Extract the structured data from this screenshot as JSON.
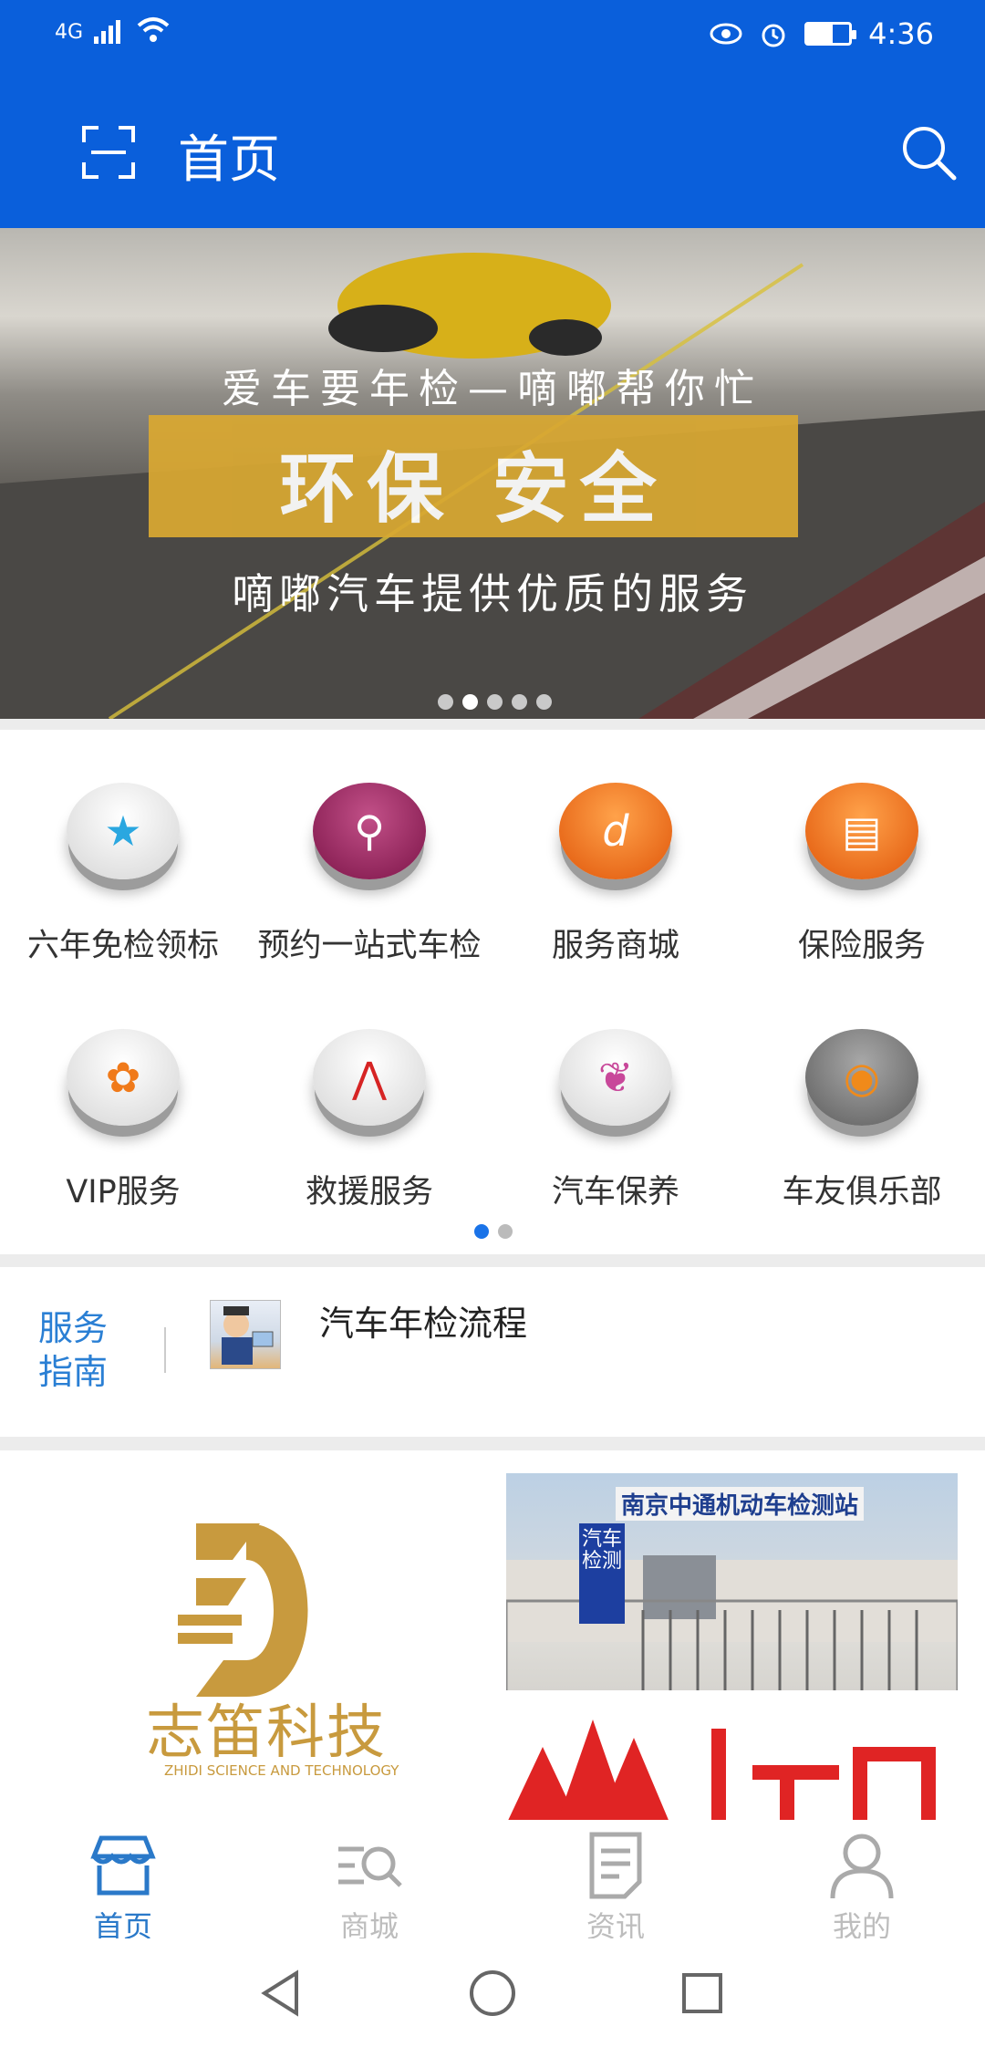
{
  "status": {
    "network": "4G",
    "time": "4:36"
  },
  "appbar": {
    "title": "首页"
  },
  "banner": {
    "line1": "爱车要年检—嘀嘟帮你忙",
    "highlight": "环保 安全",
    "line3": "嘀嘟汽车提供优质的服务",
    "active_dot": 2,
    "dot_count": 5
  },
  "services": [
    {
      "label": "六年免检领标",
      "icon": "star-icon",
      "color": "#e8e8e8"
    },
    {
      "label": "预约一站式车检",
      "icon": "key-icon",
      "color": "#a8245e"
    },
    {
      "label": "服务商城",
      "icon": "shockwave-icon",
      "color": "#f06a12"
    },
    {
      "label": "保险服务",
      "icon": "card-icon",
      "color": "#f06a12"
    },
    {
      "label": "VIP服务",
      "icon": "flower-icon",
      "color": "#e8e8e8"
    },
    {
      "label": "救援服务",
      "icon": "acrobat-icon",
      "color": "#e8e8e8"
    },
    {
      "label": "汽车保养",
      "icon": "bow-icon",
      "color": "#e8e8e8"
    },
    {
      "label": "车友俱乐部",
      "icon": "firefox-icon",
      "color": "#8a8a8a"
    }
  ],
  "guide": {
    "title": "服务指南",
    "item": "汽车年检流程"
  },
  "promo": {
    "brand_cn": "志笛科技",
    "brand_en": "ZHIDI SCIENCE AND TECHNOLOGY",
    "photo_sign": "南京中通机动车检测站",
    "photo_vsign": "汽车检测"
  },
  "tabs": [
    {
      "label": "首页",
      "icon": "store-icon",
      "active": true
    },
    {
      "label": "商城",
      "icon": "list-search-icon",
      "active": false
    },
    {
      "label": "资讯",
      "icon": "document-icon",
      "active": false
    },
    {
      "label": "我的",
      "icon": "user-icon",
      "active": false
    }
  ],
  "colors": {
    "primary": "#0a5fdb",
    "accent": "#2a79c9",
    "banner_box": "#d9a832"
  }
}
